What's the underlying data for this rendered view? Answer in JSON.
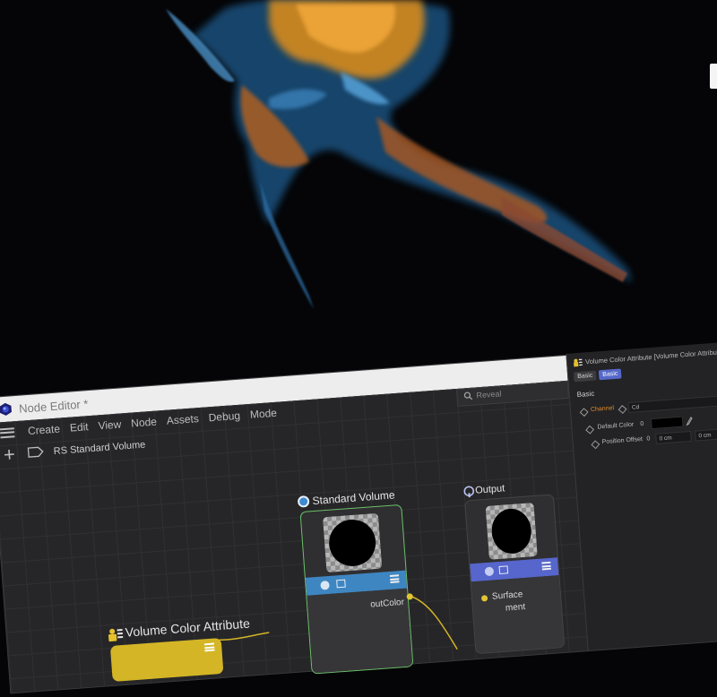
{
  "colors": {
    "accent": "#5668c9",
    "yellow_node": "#d4b526",
    "blue_band": "#3e86c2",
    "purple_band": "#5666cc"
  },
  "window": {
    "title": "Node Editor *"
  },
  "menu": [
    "Create",
    "Edit",
    "View",
    "Node",
    "Assets",
    "Debug",
    "Mode"
  ],
  "search": {
    "placeholder": "Reveal"
  },
  "breadcrumb": "RS Standard Volume",
  "nodes": {
    "volume_color": {
      "title": "Volume Color Attribute"
    },
    "standard_volume": {
      "title": "Standard Volume",
      "port_out": "outColor"
    },
    "output": {
      "title": "Output",
      "port_surface": "Surface",
      "port_partial": "ment"
    }
  },
  "attributes": {
    "header": "Volume Color Attribute [Volume Color Attribute]",
    "tabs": [
      "Basic",
      "Basic"
    ],
    "section": "Basic",
    "channel": {
      "label": "Channel",
      "value": "Cd"
    },
    "default_color": {
      "label": "Default Color"
    },
    "position_offset": {
      "label": "Position Offset",
      "x": "0 cm",
      "y": "0 cm"
    }
  }
}
